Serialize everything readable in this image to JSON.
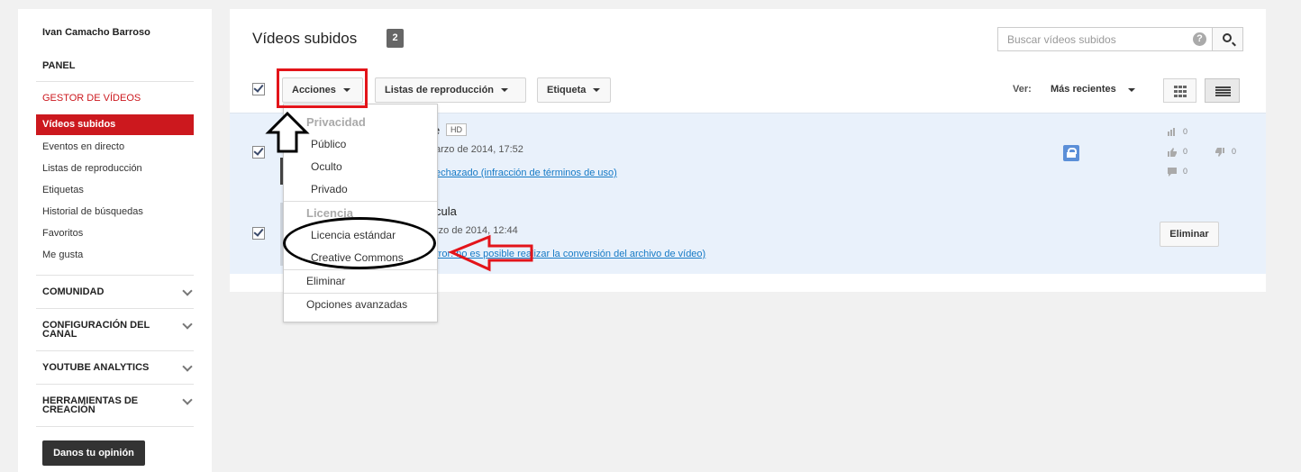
{
  "sidebar": {
    "user_name": "Ivan Camacho Barroso",
    "panel": "PANEL",
    "section_title": "GESTOR DE VÍDEOS",
    "active_item": "Vídeos subidos",
    "items": [
      "Eventos en directo",
      "Listas de reproducción",
      "Etiquetas",
      "Historial de búsquedas",
      "Favoritos",
      "Me gusta"
    ],
    "sections": [
      "COMUNIDAD",
      "CONFIGURACIÓN DEL CANAL",
      "YOUTUBE ANALYTICS",
      "HERRAMIENTAS DE CREACIÓN"
    ],
    "feedback": "Danos tu opinión"
  },
  "header": {
    "title": "Vídeos subidos",
    "count": "2",
    "search_placeholder": "Buscar vídeos subidos",
    "help": "?"
  },
  "toolbar": {
    "actions": "Acciones",
    "playlists": "Listas de reproducción",
    "tag": "Etiqueta",
    "view_label": "Ver:",
    "view_value": "Más recientes"
  },
  "videos": [
    {
      "title_fragment": "e",
      "hd": "HD",
      "date_fragment": "arzo de 2014, 17:52",
      "status_fragment": "echazado (infracción de términos de uso)",
      "views": "0",
      "likes": "0",
      "dislikes": "0",
      "comments": "0"
    },
    {
      "title_fragment": "cula",
      "date_fragment": "rzo de 2014, 12:44",
      "status_fragment": "rror: no es posible realizar la conversión del archivo de vídeo)",
      "delete_label": "Eliminar"
    }
  ],
  "menu": {
    "privacy_header": "Privacidad",
    "privacy_items": [
      "Público",
      "Oculto",
      "Privado"
    ],
    "license_header": "Licencia",
    "license_items": [
      "Licencia estándar",
      "Creative Commons"
    ],
    "delete": "Eliminar",
    "advanced": "Opciones avanzadas"
  },
  "colors": {
    "accent_red": "#cc181e",
    "link_blue": "#167ac6",
    "annotation_red": "#e3141a"
  }
}
